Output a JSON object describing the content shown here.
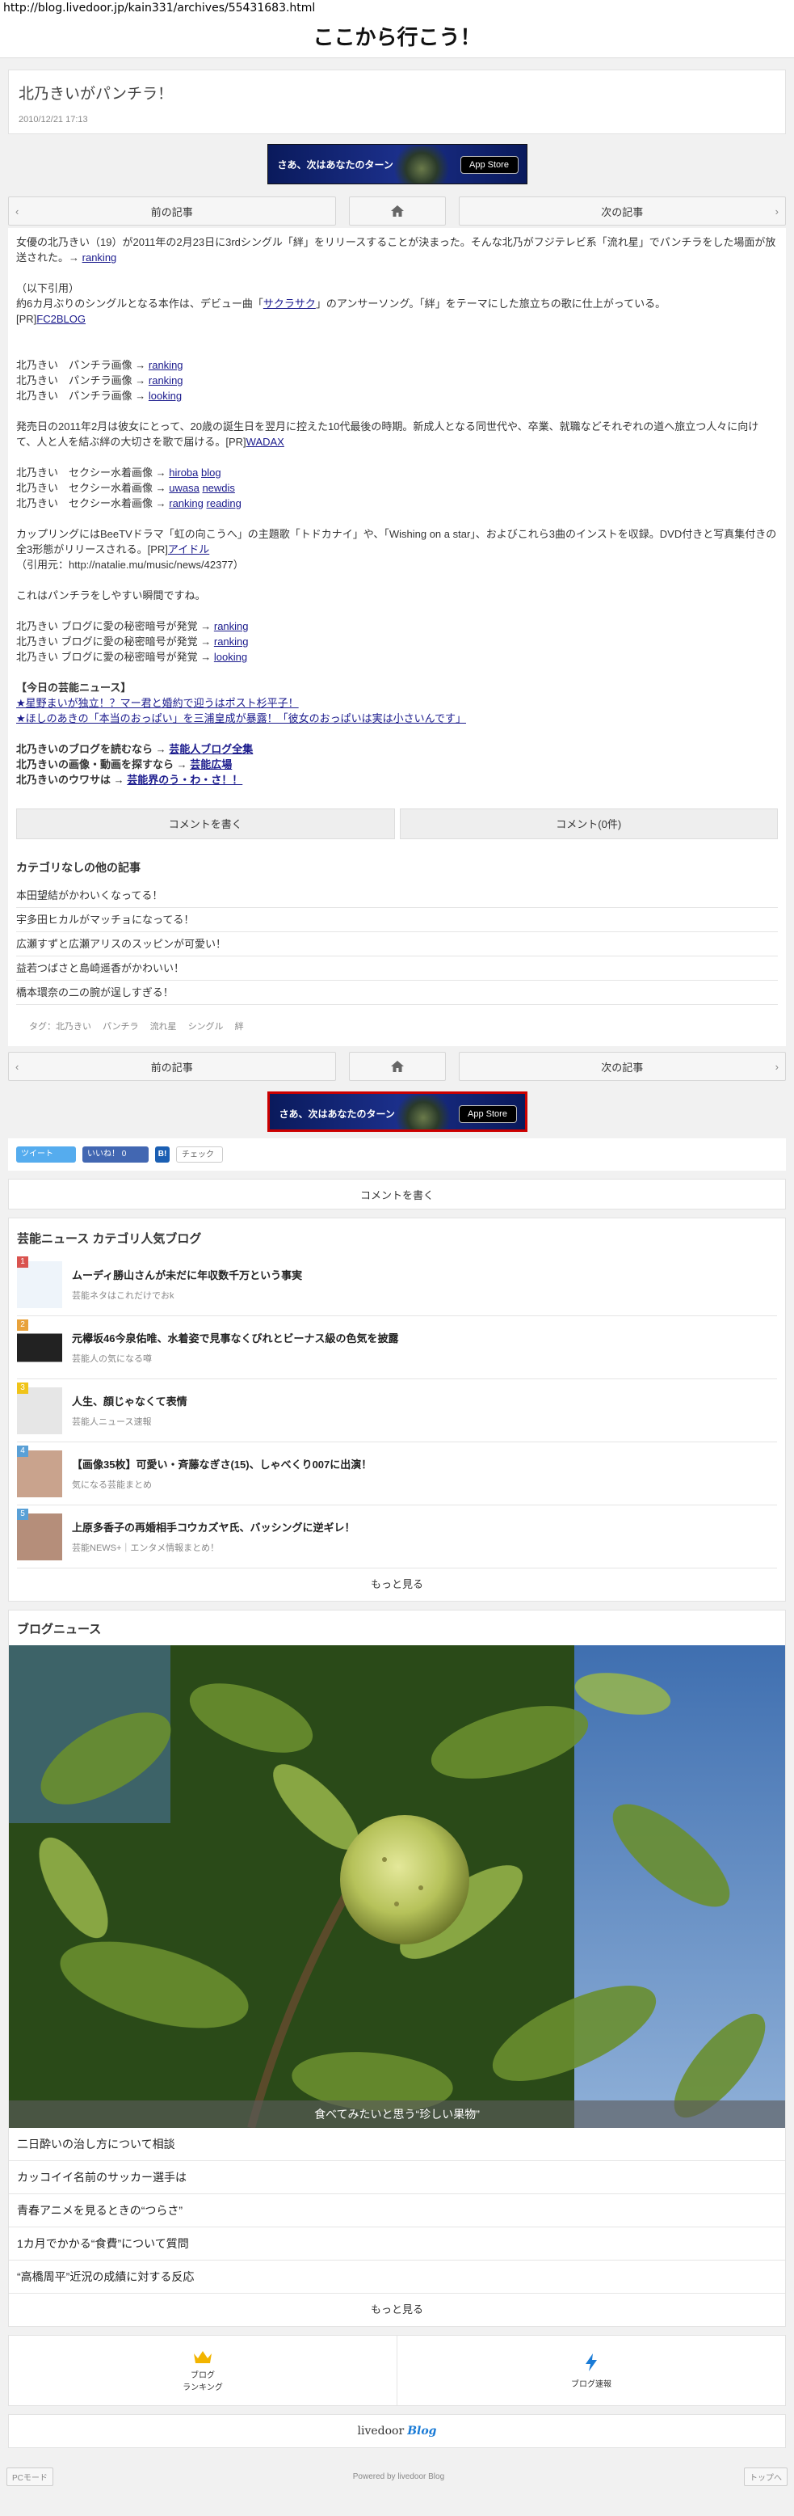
{
  "url": "http://blog.livedoor.jp/kain331/archives/55431683.html",
  "blog_title": "ここから行こう！",
  "article": {
    "title": "北乃きいがパンチラ！",
    "date": "2010/12/21 17:13"
  },
  "banner": {
    "text": "さあ、次はあなたのターン",
    "store": "App Store"
  },
  "nav": {
    "prev": "前の記事",
    "next": "次の記事"
  },
  "body": {
    "p1": "女優の北乃きい（19）が2011年の2月23日に3rdシングル「絆」をリリースすることが決まった。そんな北乃がフジテレビ系「流れ星」でパンチラをした場面が放送された。→",
    "p1_link": "ranking",
    "quote_head": "（以下引用）",
    "q1": "約6カ月ぶりのシングルとなる本作は、デビュー曲「",
    "q1_link": "サクラサク",
    "q1_tail": "」のアンサーソング。「絆」をテーマにした旅立ちの歌に仕上がっている。",
    "q1_pr": "[PR]",
    "q1_pr_link": "FC2BLOG",
    "panchira": [
      {
        "label": "北乃きい　パンチラ画像 →",
        "link": "ranking"
      },
      {
        "label": "北乃きい　パンチラ画像 →",
        "link": "ranking"
      },
      {
        "label": "北乃きい　パンチラ画像 →",
        "link": "looking"
      }
    ],
    "p2": "発売日の2011年2月は彼女にとって、20歳の誕生日を翌月に控えた10代最後の時期。新成人となる同世代や、卒業、就職などそれぞれの道へ旅立つ人々に向けて、人と人を結ぶ絆の大切さを歌で届ける。",
    "p2_pr": "[PR]",
    "p2_pr_link": "WADAX",
    "sexy": [
      {
        "label": "北乃きい　セクシー水着画像 →",
        "link1": "hiroba",
        "link2": "blog"
      },
      {
        "label": "北乃きい　セクシー水着画像 →",
        "link1": "uwasa",
        "link2": "newdis"
      },
      {
        "label": "北乃きい　セクシー水着画像 →",
        "link1": "ranking",
        "link2": "reading"
      }
    ],
    "p3": "カップリングにはBeeTVドラマ「虹の向こうへ」の主題歌「トドカナイ」や、「Wishing on a star」、およびこれら3曲のインストを収録。DVD付きと写真集付きの全3形態がリリースされる。",
    "p3_pr": "[PR]",
    "p3_pr_link": "アイドル",
    "p3_src": "（引用元：http://natalie.mu/music/news/42377）",
    "p4": "これはパンチラをしやすい瞬間ですね。",
    "secret": [
      {
        "label": "北乃きい ブログに愛の秘密暗号が発覚 →",
        "link": "ranking"
      },
      {
        "label": "北乃きい ブログに愛の秘密暗号が発覚 →",
        "link": "ranking"
      },
      {
        "label": "北乃きい ブログに愛の秘密暗号が発覚 →",
        "link": "looking"
      }
    ],
    "news_head": "【今日の芸能ニュース】",
    "news1": "★星野まいが独立！？マー君と婚約で迎うはポスト杉平子！",
    "news2": "★ほしのあきの「本当のおっぱい」を三浦皇成が暴露！「彼女のおっぱいは実は小さいんです」",
    "more": [
      {
        "label": "北乃きいのブログを読むなら →",
        "link": "芸能人ブログ全集"
      },
      {
        "label": "北乃きいの画像・動画を探すなら →",
        "link": "芸能広場"
      },
      {
        "label": "北乃きいのウワサは →",
        "link": "芸能界のう・わ・さ！！"
      }
    ]
  },
  "comment_buttons": {
    "write": "コメントを書く",
    "count": "コメント(0件)"
  },
  "other": {
    "title": "カテゴリなしの他の記事",
    "items": [
      "本田望結がかわいくなってる！",
      "宇多田ヒカルがマッチョになってる！",
      "広瀬すずと広瀬アリスのスッピンが可愛い！",
      "益若つばさと島崎遥香がかわいい！",
      "橋本環奈の二の腕が逞しすぎる！"
    ]
  },
  "tags": {
    "label": "タグ：",
    "items": [
      "北乃きい",
      "パンチラ",
      "流れ星",
      "シングル",
      "絆"
    ]
  },
  "social": {
    "tweet": "ツイート",
    "like": "いいね！ 0",
    "bm": "B!",
    "check": "チェック"
  },
  "comment_write": "コメントを書く",
  "ranking": {
    "title": "芸能ニュース カテゴリ人気ブログ",
    "items": [
      {
        "rank": "1",
        "title": "ムーディ勝山さんが未だに年収数千万という事実",
        "source": "芸能ネタはこれだけでおk",
        "color": "#d9534f"
      },
      {
        "rank": "2",
        "title": "元欅坂46今泉佑唯、水着姿で見事なくびれとビーナス級の色気を披露",
        "source": "芸能人の気になる噂",
        "color": "#e8a23b"
      },
      {
        "rank": "3",
        "title": "人生、顔じゃなくて表情",
        "source": "芸能人ニュース速報",
        "color": "#f0c419"
      },
      {
        "rank": "4",
        "title": "【画像35枚】可愛い・斉藤なぎさ(15)、しゃべくり007に出演！",
        "source": "気になる芸能まとめ",
        "color": "#5aa0d6"
      },
      {
        "rank": "5",
        "title": "上原多香子の再婚相手コウカズヤ氏、バッシングに逆ギレ！",
        "source": "芸能NEWS+｜エンタメ情報まとめ！",
        "color": "#5aa0d6"
      }
    ],
    "more": "もっと見る"
  },
  "blog_news": {
    "title": "ブログニュース",
    "caption": "食べてみたいと思う“珍しい果物”",
    "items": [
      "二日酔いの治し方について相談",
      "カッコイイ名前のサッカー選手は",
      "青春アニメを見るときの“つらさ”",
      "1カ月でかかる“食費”について質問",
      "“高橋周平”近況の成績に対する反応"
    ],
    "more": "もっと見る"
  },
  "bottom_nav": {
    "ranking": "ブログ\nランキング",
    "breaking": "ブログ速報"
  },
  "logo": {
    "livedoor": "livedoor",
    "blog": "Blog"
  },
  "footer": {
    "pc": "PCモード",
    "powered": "Powered by livedoor Blog",
    "top": "トップへ"
  }
}
